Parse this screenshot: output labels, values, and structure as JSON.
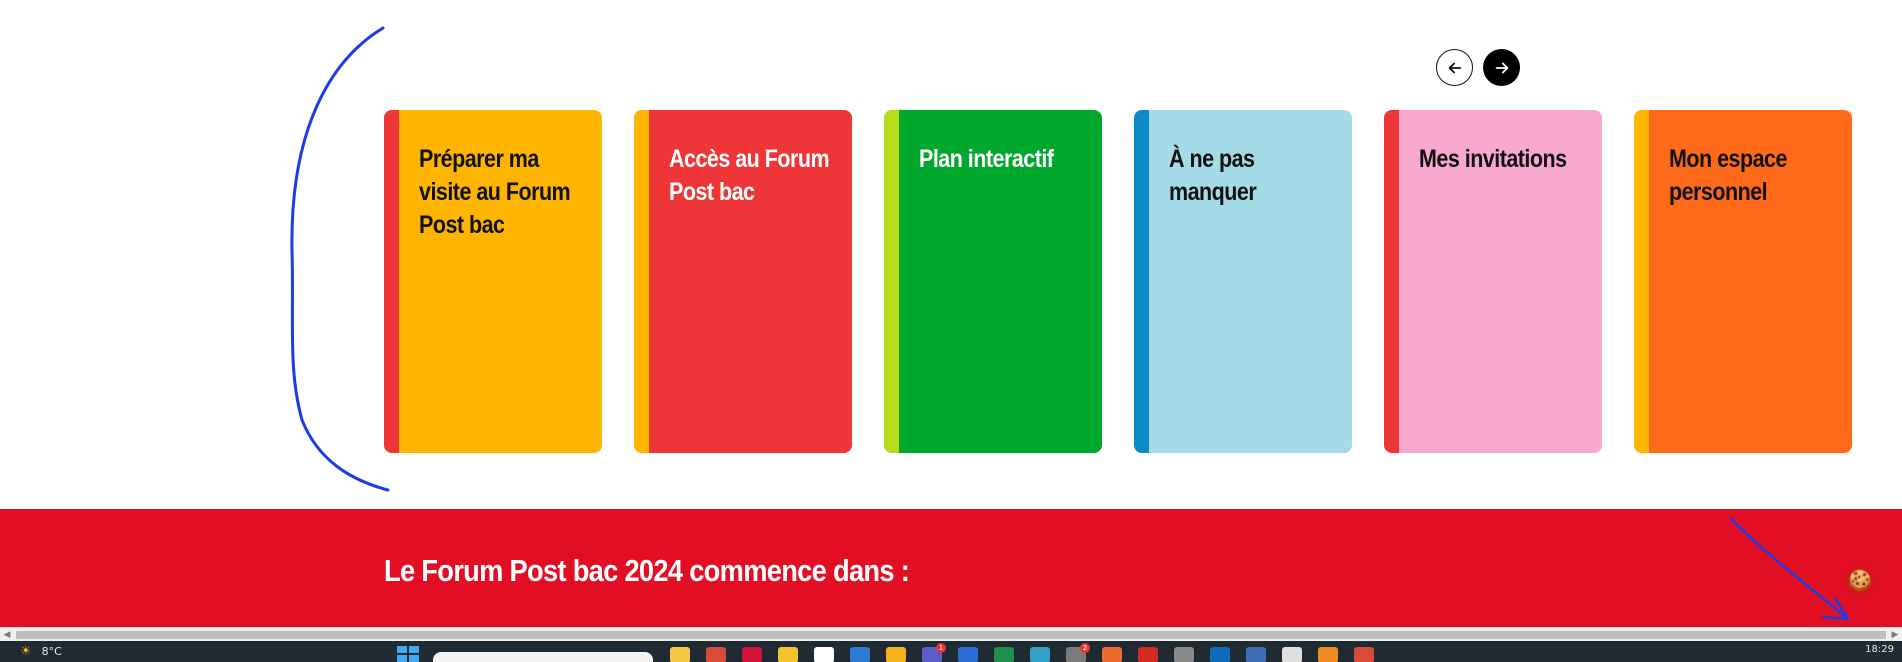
{
  "carousel": {
    "cards": [
      {
        "title": "Préparer ma visite au Forum Post bac",
        "bg": "#ffb500",
        "stripe": "#ee3537",
        "text_color": "#111111"
      },
      {
        "title": "Accès au Forum Post bac",
        "bg": "#ee3537",
        "stripe": "#ffb500",
        "text_color": "#ffffff"
      },
      {
        "title": "Plan interactif",
        "bg": "#00a82d",
        "stripe": "#b5dd1a",
        "text_color": "#ffffff"
      },
      {
        "title": "À ne pas manquer",
        "bg": "#a5dbe7",
        "stripe": "#0a8ac7",
        "text_color": "#111111"
      },
      {
        "title": "Mes invitations",
        "bg": "#f8a7cf",
        "stripe": "#ee3537",
        "text_color": "#111111"
      },
      {
        "title": "Mon espace personnel",
        "bg": "#ff6a1a",
        "stripe": "#ffb500",
        "text_color": "#111111"
      }
    ],
    "prev_icon": "arrow-left-icon",
    "next_icon": "arrow-right-icon"
  },
  "countdown": {
    "headline": "Le Forum Post bac 2024 commence dans :",
    "band_color": "#e20e24"
  },
  "cookie_icon": "cookie-icon",
  "taskbar": {
    "temperature": "8°C",
    "clock": "18:29",
    "icons": [
      {
        "name": "file-explorer-icon",
        "color": "#f6c945",
        "badge": ""
      },
      {
        "name": "chrome-icon",
        "color": "#d94a38",
        "badge": ""
      },
      {
        "name": "app-red-icon",
        "color": "#d2143a",
        "badge": ""
      },
      {
        "name": "app-yellow-icon",
        "color": "#f4c430",
        "badge": ""
      },
      {
        "name": "app-white-icon",
        "color": "#ffffff",
        "badge": ""
      },
      {
        "name": "mail-icon",
        "color": "#2e7cd6",
        "badge": ""
      },
      {
        "name": "folder-icon",
        "color": "#f3b21b",
        "badge": ""
      },
      {
        "name": "teams-icon",
        "color": "#5b5fc7",
        "badge": "1"
      },
      {
        "name": "word-icon",
        "color": "#2b6cd6",
        "badge": ""
      },
      {
        "name": "excel-icon",
        "color": "#1f8f4e",
        "badge": ""
      },
      {
        "name": "browser-icon",
        "color": "#32a1c9",
        "badge": ""
      },
      {
        "name": "chat-icon",
        "color": "#7a7a7a",
        "badge": "2"
      },
      {
        "name": "app-orange-icon",
        "color": "#ef6a2e",
        "badge": ""
      },
      {
        "name": "acrobat-icon",
        "color": "#d52b1e",
        "badge": ""
      },
      {
        "name": "printer-icon",
        "color": "#8a8a8a",
        "badge": ""
      },
      {
        "name": "outlook-icon",
        "color": "#0f6cbd",
        "badge": ""
      },
      {
        "name": "remote-icon",
        "color": "#3c6fb6",
        "badge": ""
      },
      {
        "name": "notepad-icon",
        "color": "#e0e0e0",
        "badge": ""
      },
      {
        "name": "app-orange2-icon",
        "color": "#f08c1e",
        "badge": ""
      },
      {
        "name": "chrome-active-icon",
        "color": "#d94a38",
        "badge": ""
      }
    ]
  }
}
